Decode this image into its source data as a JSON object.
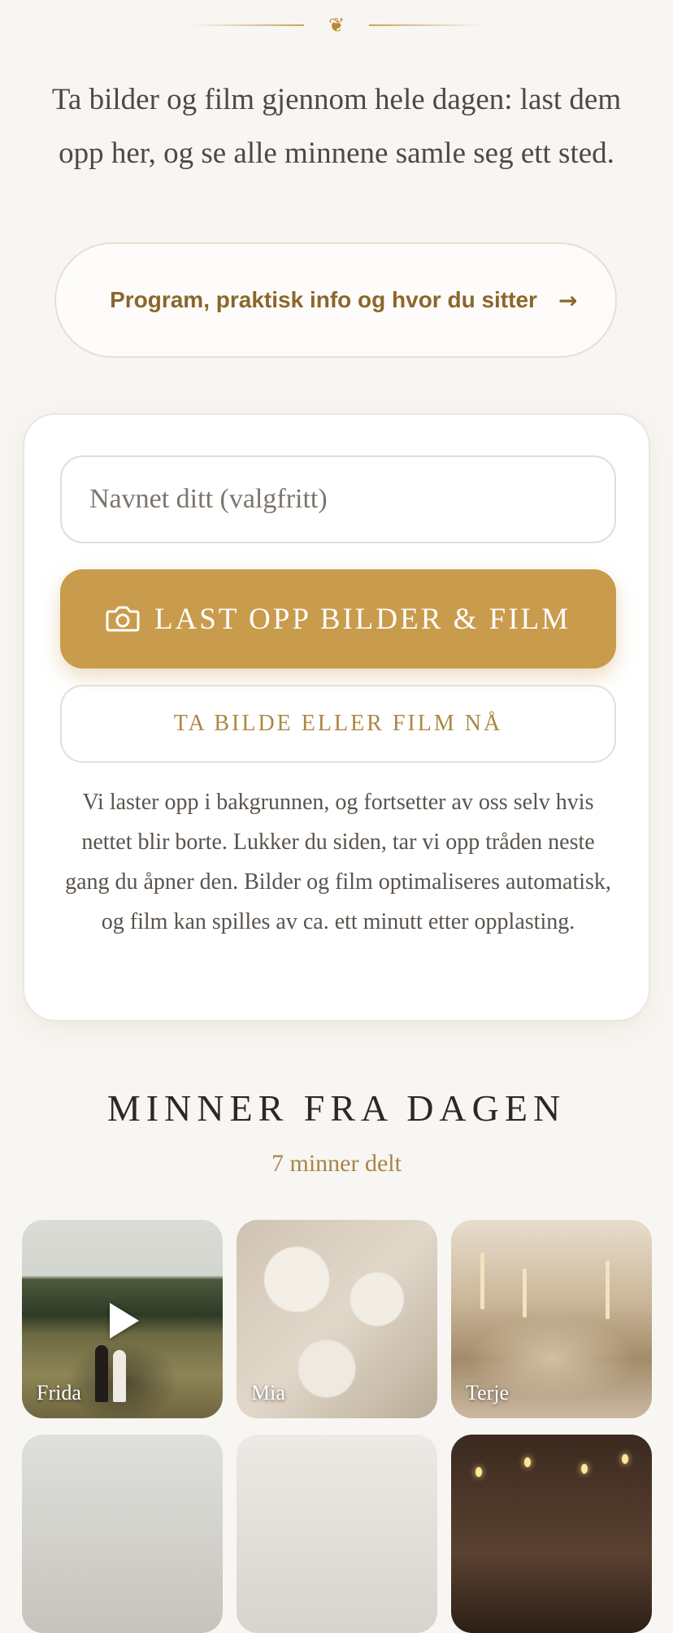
{
  "header": {
    "ornament_icon": "leaf-ornament-icon",
    "intro_text": "Ta bilder og film gjennom hele dagen: last dem opp her, og se alle minnene samle seg ett sted."
  },
  "info_button": {
    "label": "Program, praktisk info og hvor du sitter",
    "arrow": "→"
  },
  "upload_card": {
    "name_placeholder": "Navnet ditt (valgfritt)",
    "name_value": "",
    "upload_label": "LAST OPP BILDER & FILM",
    "upload_icon": "camera-icon",
    "capture_label": "TA BILDE ELLER FILM NÅ",
    "note": "Vi laster opp i bakgrunnen, og fortsetter av oss selv hvis nettet blir borte. Lukker du siden, tar vi opp tråden neste gang du åpner den. Bilder og film optimaliseres automatisk, og film kan spilles av ca. ett minutt etter opplasting."
  },
  "memories": {
    "title": "MINNER FRA DAGEN",
    "count_text": "7 minner delt",
    "items": [
      {
        "name": "Frida",
        "is_video": true
      },
      {
        "name": "Mia",
        "is_video": false
      },
      {
        "name": "Terje",
        "is_video": false
      },
      {
        "name": "",
        "is_video": false
      },
      {
        "name": "",
        "is_video": false
      },
      {
        "name": "",
        "is_video": false
      }
    ]
  },
  "colors": {
    "background": "#f8f6f2",
    "accent": "#c99b4c",
    "accent_text": "#8b672b"
  }
}
